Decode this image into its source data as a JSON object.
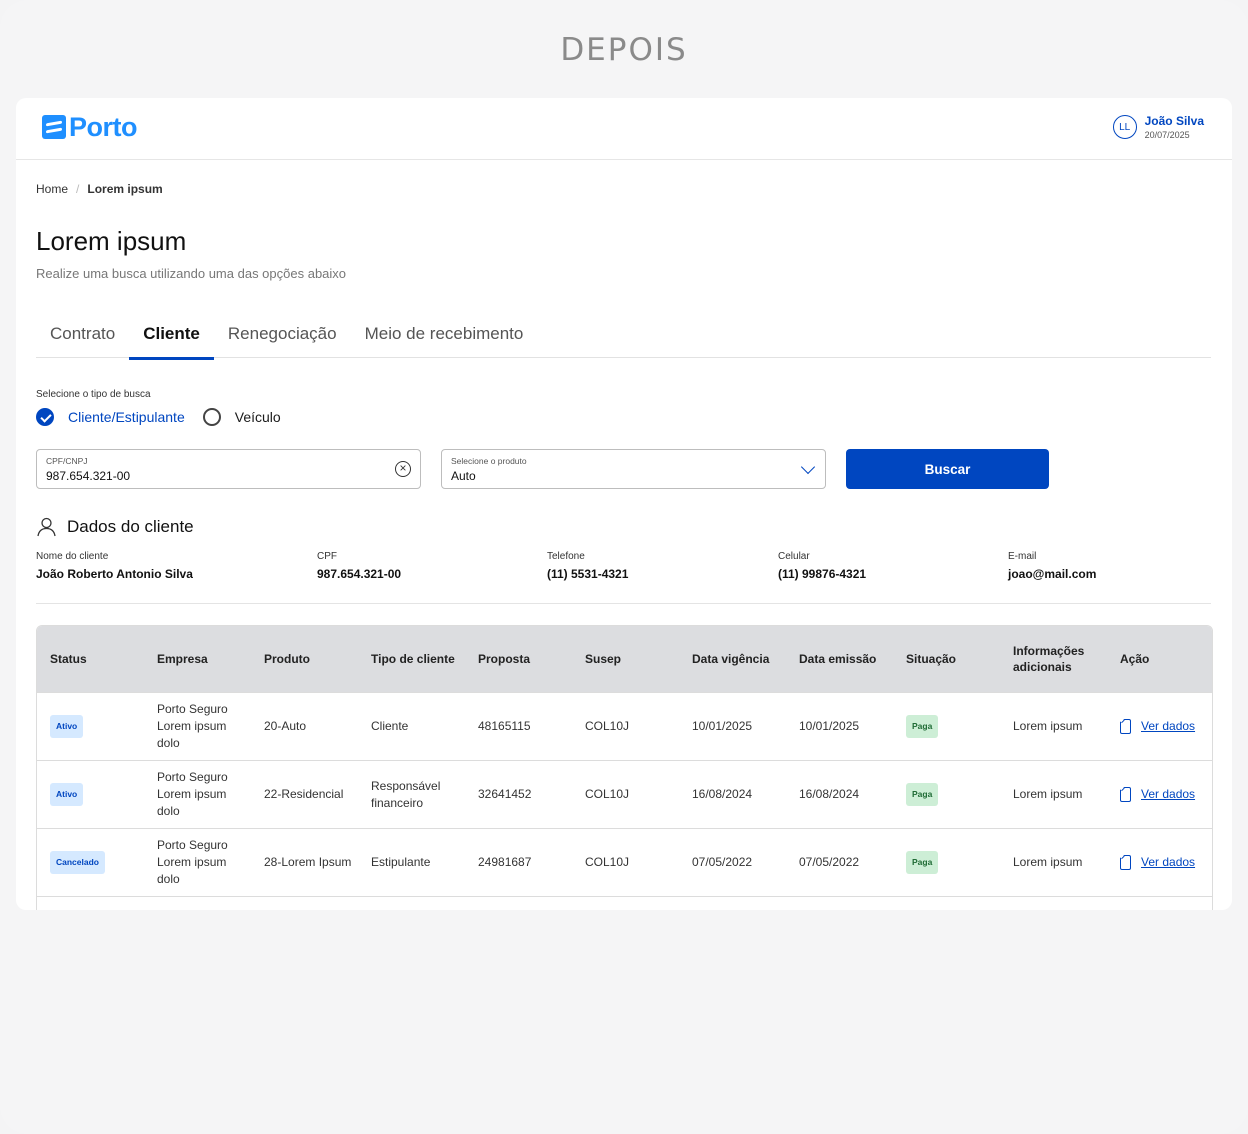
{
  "caption": "DEPOIS",
  "header": {
    "logo_text": "Porto",
    "user_initials": "LL",
    "user_name": "João Silva",
    "user_date": "20/07/2025"
  },
  "breadcrumb": {
    "home": "Home",
    "current": "Lorem ipsum"
  },
  "page": {
    "title": "Lorem ipsum",
    "subtitle": "Realize uma busca utilizando uma das opções abaixo"
  },
  "tabs": [
    {
      "label": "Contrato"
    },
    {
      "label": "Cliente",
      "active": true
    },
    {
      "label": "Renegociação"
    },
    {
      "label": "Meio de recebimento"
    }
  ],
  "search": {
    "type_label": "Selecione o tipo de busca",
    "options": [
      {
        "label": "Cliente/Estipulante",
        "selected": true
      },
      {
        "label": "Veículo",
        "selected": false
      }
    ],
    "cpf_label": "CPF/CNPJ",
    "cpf_value": "987.654.321-00",
    "product_label": "Selecione o produto",
    "product_value": "Auto",
    "button": "Buscar"
  },
  "client": {
    "heading": "Dados do cliente",
    "fields": [
      {
        "label": "Nome do cliente",
        "value": "João Roberto Antonio Silva"
      },
      {
        "label": "CPF",
        "value": "987.654.321-00"
      },
      {
        "label": "Telefone",
        "value": "(11) 5531-4321"
      },
      {
        "label": "Celular",
        "value": "(11) 99876-4321"
      },
      {
        "label": "E-mail",
        "value": "joao@mail.com"
      }
    ]
  },
  "table": {
    "headers": [
      "Status",
      "Empresa",
      "Produto",
      "Tipo de cliente",
      "Proposta",
      "Susep",
      "Data vigência",
      "Data emissão",
      "Situação",
      "Informações adicionais",
      "Ação"
    ],
    "rows": [
      {
        "status": "Ativo",
        "empresa": "Porto Seguro Lorem ipsum dolo",
        "produto": "20-Auto",
        "tipo": "Cliente",
        "proposta": "48165115",
        "susep": "COL10J",
        "vigencia": "10/01/2025",
        "emissao": "10/01/2025",
        "situacao": "Paga",
        "info": "Lorem ipsum",
        "acao": "Ver dados"
      },
      {
        "status": "Ativo",
        "empresa": "Porto Seguro Lorem ipsum dolo",
        "produto": "22-Residencial",
        "tipo": "Responsável financeiro",
        "proposta": "32641452",
        "susep": "COL10J",
        "vigencia": "16/08/2024",
        "emissao": "16/08/2024",
        "situacao": "Paga",
        "info": "Lorem ipsum",
        "acao": "Ver dados"
      },
      {
        "status": "Cancelado",
        "empresa": "Porto Seguro Lorem ipsum dolo",
        "produto": "28-Lorem Ipsum",
        "tipo": "Estipulante",
        "proposta": "24981687",
        "susep": "COL10J",
        "vigencia": "07/05/2022",
        "emissao": "07/05/2022",
        "situacao": "Paga",
        "info": "Lorem ipsum",
        "acao": "Ver dados"
      }
    ]
  },
  "colors": {
    "primary": "#0046c0",
    "logo": "#1f8fff"
  }
}
